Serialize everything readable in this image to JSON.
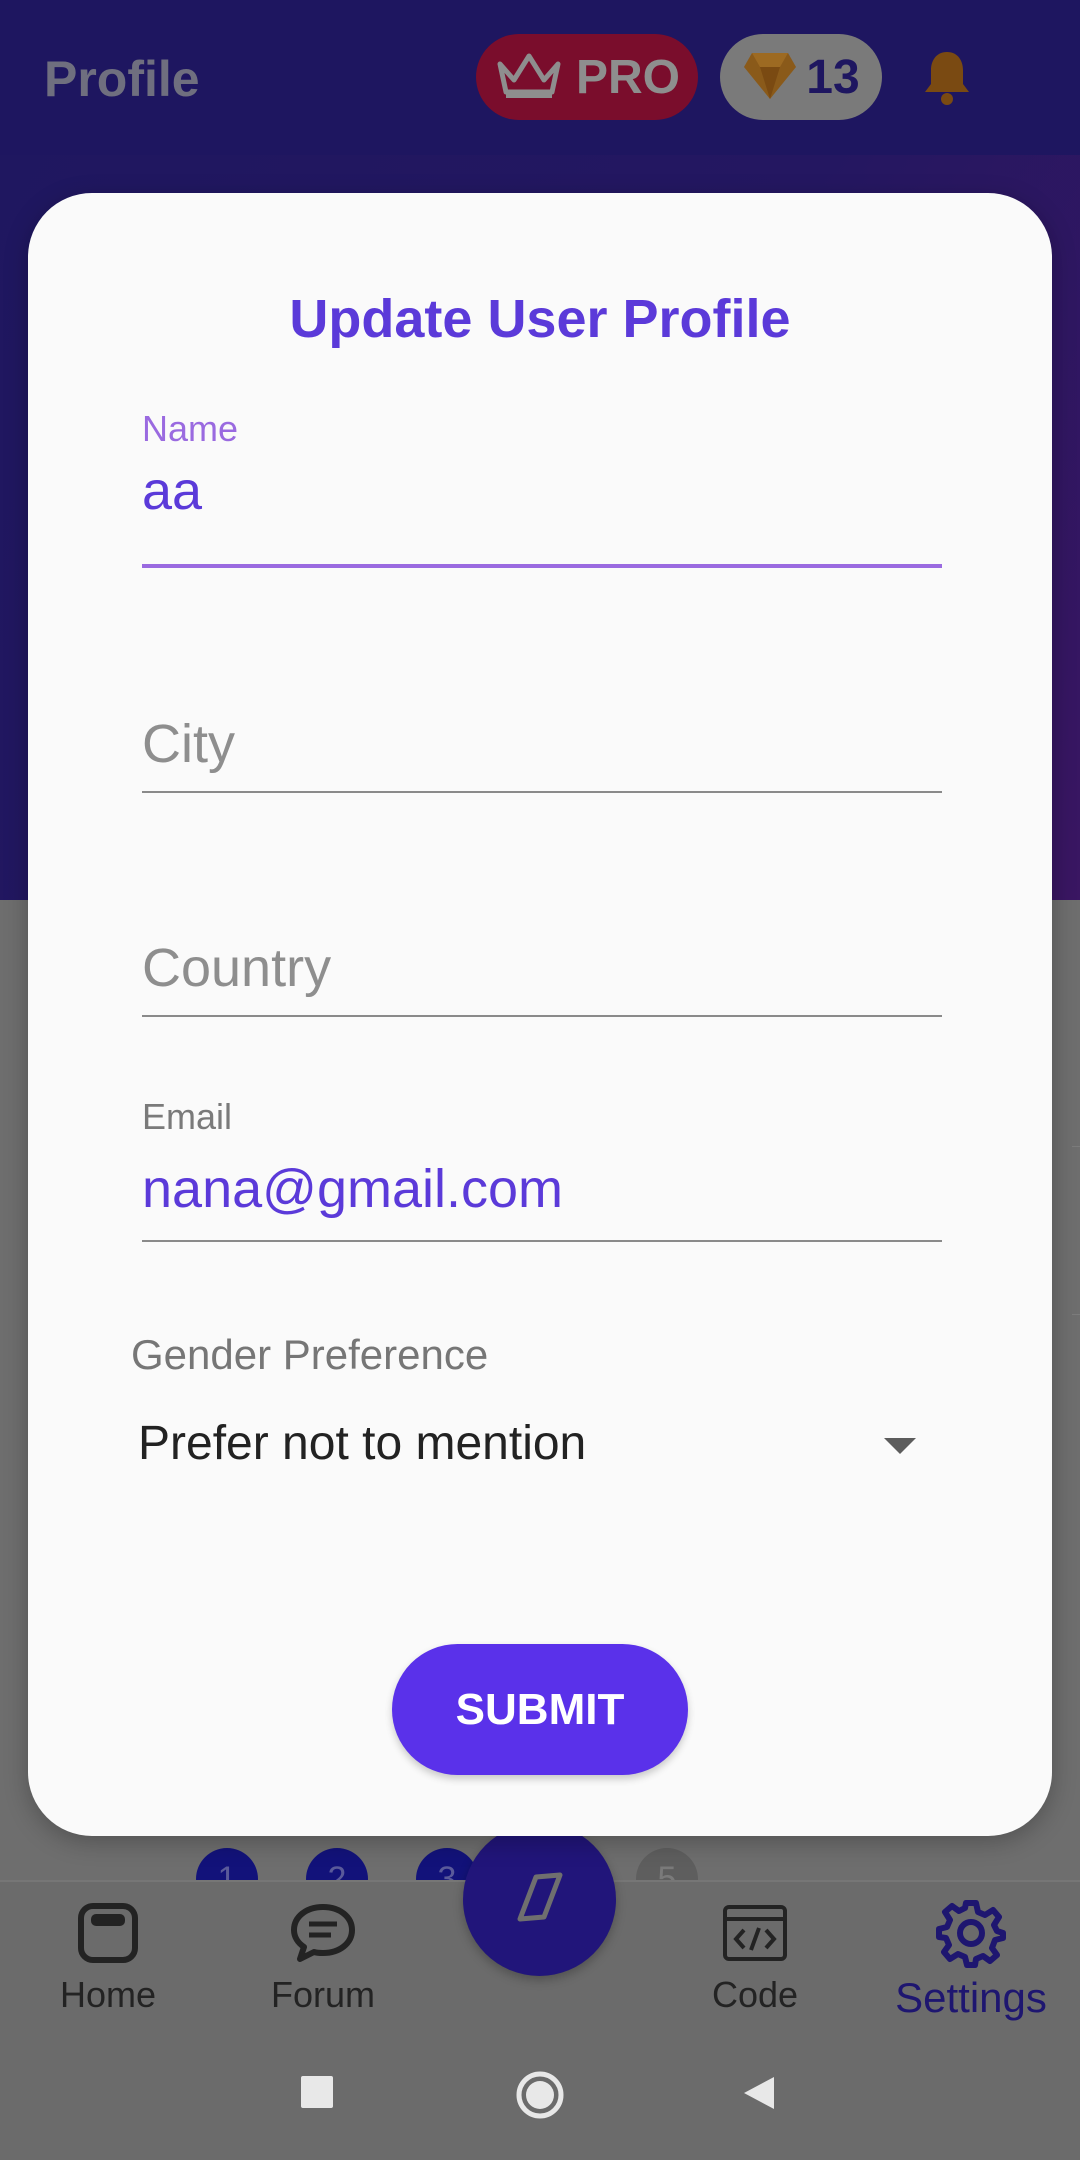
{
  "header": {
    "title": "Profile",
    "pro_label": "PRO",
    "gems_count": "13"
  },
  "dialog": {
    "title": "Update User Profile",
    "name": {
      "label": "Name",
      "value": "aa"
    },
    "city": {
      "placeholder": "City"
    },
    "country": {
      "placeholder": "Country"
    },
    "email": {
      "label": "Email",
      "value": "nana@gmail.com"
    },
    "gender": {
      "label": "Gender Preference",
      "selected": "Prefer not to mention"
    },
    "submit_label": "SUBMIT"
  },
  "page_dots": [
    "1",
    "2",
    "3",
    "5"
  ],
  "bottom_nav": {
    "items": [
      {
        "label": "Home",
        "icon": "home-icon"
      },
      {
        "label": "Forum",
        "icon": "chat-icon"
      },
      {
        "label": "Code",
        "icon": "code-icon"
      },
      {
        "label": "Settings",
        "icon": "gear-icon"
      }
    ],
    "fab_icon": "compass-icon",
    "active": "Settings"
  },
  "colors": {
    "accent": "#5a31ea",
    "header": "#1e1660",
    "title": "#5b3ad9"
  }
}
